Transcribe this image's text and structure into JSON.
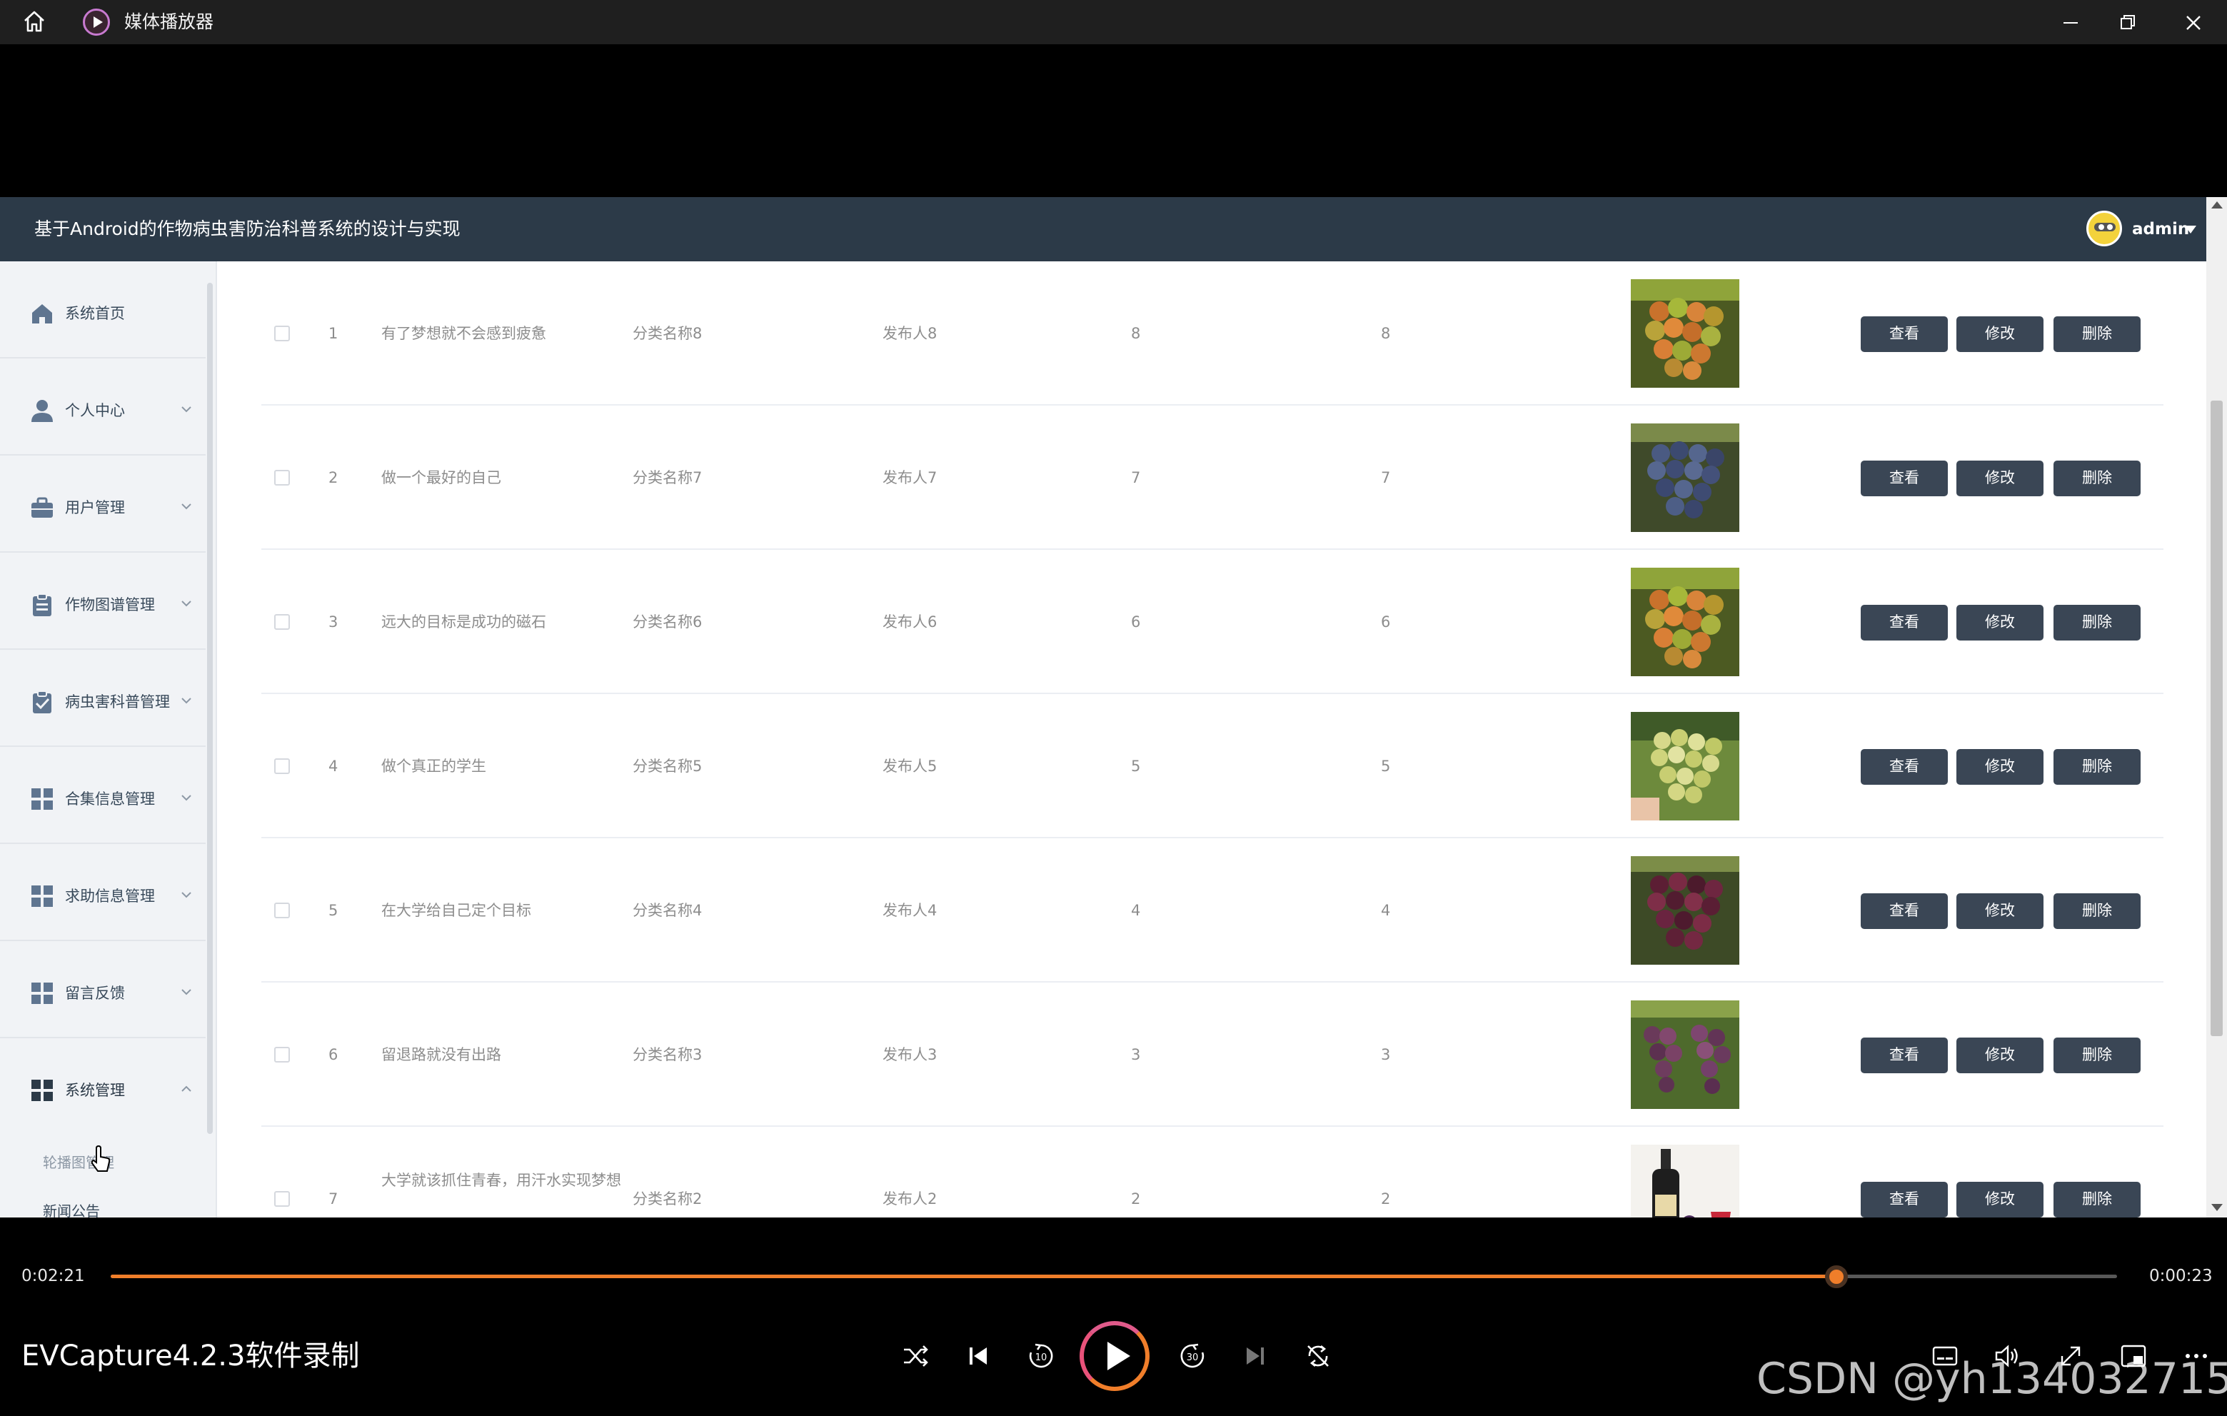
{
  "player": {
    "app_title": "媒体播放器",
    "time_elapsed": "0:02:21",
    "time_remaining": "0:00:23",
    "progress_fraction": 0.86,
    "recording_label": "EVCapture4.2.3软件录制",
    "watermark": "CSDN @yh1340327157",
    "accent_color": "#f07e2a"
  },
  "app": {
    "system_title": "基于Android的作物病虫害防治科普系统的设计与实现",
    "user_name": "admin"
  },
  "sidebar": {
    "items": [
      {
        "label": "系统首页",
        "icon": "home-icon"
      },
      {
        "label": "个人中心",
        "icon": "person-icon"
      },
      {
        "label": "用户管理",
        "icon": "briefcase-icon"
      },
      {
        "label": "作物图谱管理",
        "icon": "clipboard-icon"
      },
      {
        "label": "病虫害科普管理",
        "icon": "clipboard-check-icon"
      },
      {
        "label": "合集信息管理",
        "icon": "grid-icon"
      },
      {
        "label": "求助信息管理",
        "icon": "grid-icon"
      },
      {
        "label": "留言反馈",
        "icon": "grid-icon"
      },
      {
        "label": "系统管理",
        "icon": "grid-icon"
      }
    ],
    "sub_items": [
      "轮播图管理",
      "新闻公告"
    ]
  },
  "table": {
    "rows": [
      {
        "index": "1",
        "title": "有了梦想就不会感到疲惫",
        "category": "分类名称8",
        "publisher": "发布人8",
        "col_a": "8",
        "col_b": "8",
        "image": "orange-grapes"
      },
      {
        "index": "2",
        "title": "做一个最好的自己",
        "category": "分类名称7",
        "publisher": "发布人7",
        "col_a": "7",
        "col_b": "7",
        "image": "blue-grapes"
      },
      {
        "index": "3",
        "title": "远大的目标是成功的磁石",
        "category": "分类名称6",
        "publisher": "发布人6",
        "col_a": "6",
        "col_b": "6",
        "image": "orange-grapes"
      },
      {
        "index": "4",
        "title": "做个真正的学生",
        "category": "分类名称5",
        "publisher": "发布人5",
        "col_a": "5",
        "col_b": "5",
        "image": "green-grapes"
      },
      {
        "index": "5",
        "title": "在大学给自己定个目标",
        "category": "分类名称4",
        "publisher": "发布人4",
        "col_a": "4",
        "col_b": "4",
        "image": "dark-red-grapes"
      },
      {
        "index": "6",
        "title": "留退路就没有出路",
        "category": "分类名称3",
        "publisher": "发布人3",
        "col_a": "3",
        "col_b": "3",
        "image": "purple-grapes"
      },
      {
        "index": "7",
        "title": "大学就该抓住青春，用汗水实现梦想",
        "category": "分类名称2",
        "publisher": "发布人2",
        "col_a": "2",
        "col_b": "2",
        "image": "wine-bottle"
      }
    ],
    "actions": {
      "view": "查看",
      "edit": "修改",
      "delete": "删除"
    }
  }
}
